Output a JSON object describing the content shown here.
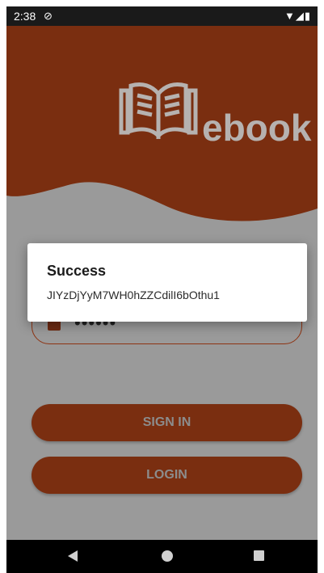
{
  "status_bar": {
    "time": "2:38",
    "sync_icon": "sync-off-icon",
    "wifi_icon": "wifi-icon",
    "signal_icon": "signal-icon",
    "battery_icon": "battery-icon"
  },
  "header": {
    "logo_text": "ebook",
    "logo_icon": "book-icon",
    "color": "#7a2e10"
  },
  "login_form": {
    "password_value": "••••••",
    "lock_icon": "lock-icon"
  },
  "buttons": {
    "sign_in_label": "SIGN IN",
    "login_label": "LOGIN"
  },
  "dialog": {
    "title": "Success",
    "message": "JIYzDjYyM7WH0hZZCdilI6bOthu1"
  },
  "nav_bar": {
    "back_icon": "back-triangle-icon",
    "home_icon": "home-circle-icon",
    "recents_icon": "recents-square-icon"
  },
  "colors": {
    "brand": "#7a2e10",
    "scrim_background": "#9a9a9a",
    "dialog_background": "#ffffff"
  }
}
